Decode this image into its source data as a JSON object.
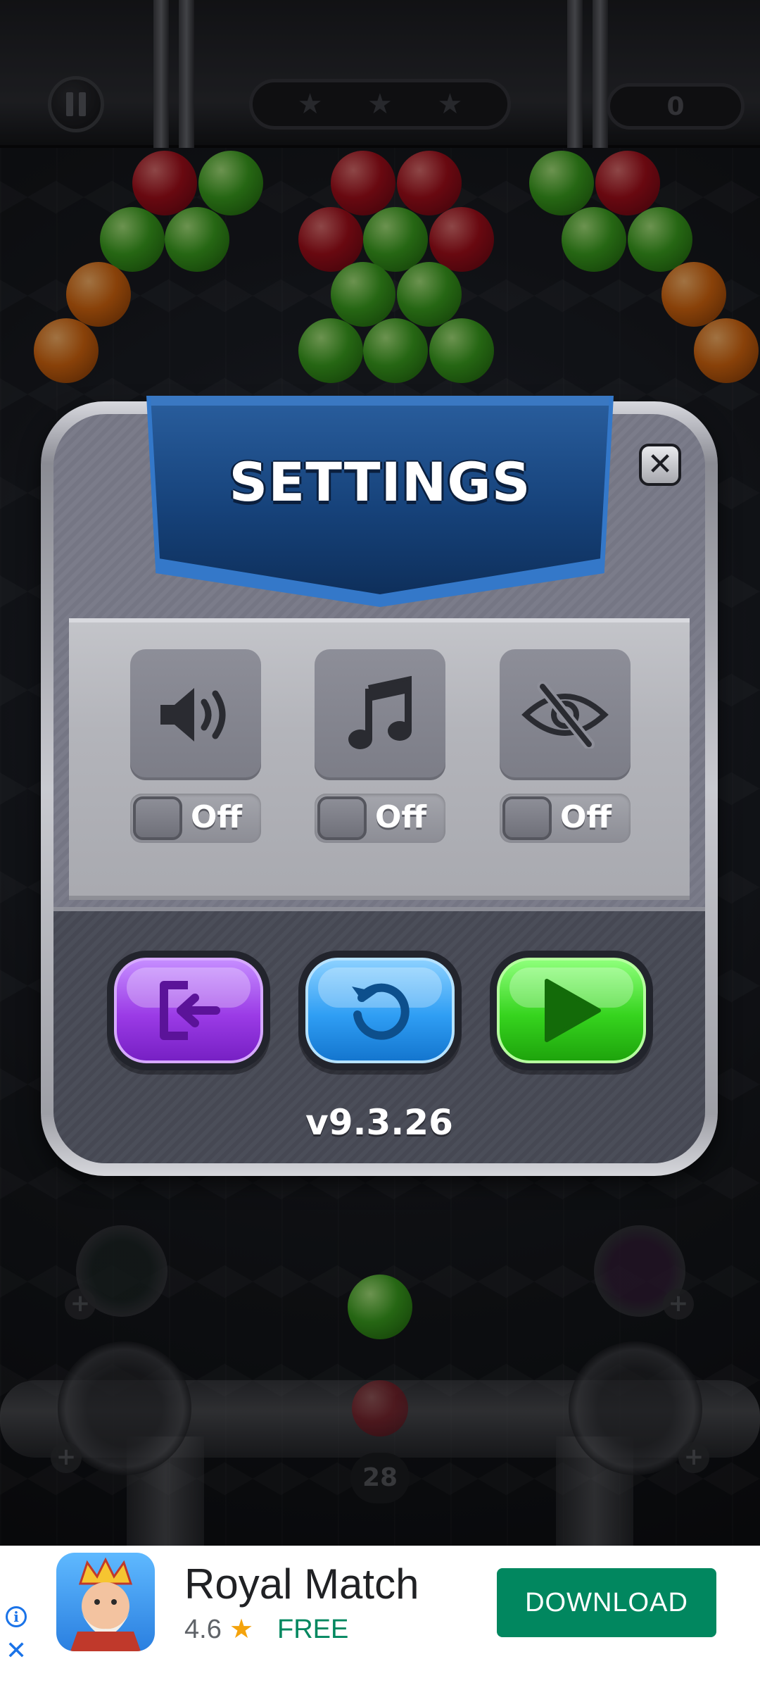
{
  "hud": {
    "score": "0",
    "star_glyph": "★",
    "moves_left": "28"
  },
  "settings": {
    "title": "SETTINGS",
    "close_glyph": "✕",
    "toggles": [
      {
        "id": "sound",
        "icon": "speaker-icon",
        "state_label": "Off"
      },
      {
        "id": "music",
        "icon": "music-note-icon",
        "state_label": "Off"
      },
      {
        "id": "visibility",
        "icon": "eye-slash-icon",
        "state_label": "Off"
      }
    ],
    "actions": [
      {
        "id": "exit",
        "icon": "exit-icon",
        "color": "#9b3be6"
      },
      {
        "id": "restart",
        "icon": "restart-icon",
        "color": "#2f9ef4"
      },
      {
        "id": "play",
        "icon": "play-icon",
        "color": "#36d41e"
      }
    ],
    "version": "v9.3.26"
  },
  "ad": {
    "app_name": "Royal Match",
    "rating": "4.6",
    "star_glyph": "★",
    "price": "FREE",
    "cta": "DOWNLOAD",
    "info_glyph": "i",
    "close_glyph": "✕"
  },
  "colors": {
    "banner_blue": "#16427a",
    "cta_green": "#01875f"
  }
}
